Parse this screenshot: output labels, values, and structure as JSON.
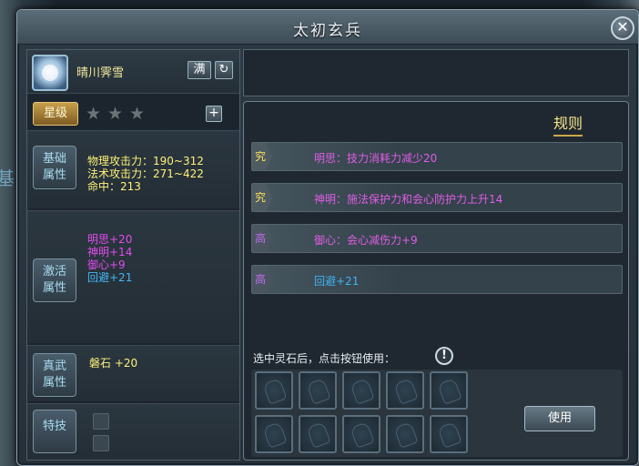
{
  "window": {
    "title": "太初玄兵",
    "close_label": "✕"
  },
  "item": {
    "name": "晴川霁雪",
    "full_label": "满",
    "refresh_label": "↻"
  },
  "star": {
    "label": "星级",
    "stars": [
      "★",
      "★",
      "★"
    ],
    "add_label": "+"
  },
  "sections": {
    "basic": {
      "label1": "基础",
      "label2": "属性",
      "lines": [
        "物理攻击力：190~312",
        "法术攻击力：271~422",
        "命中：213"
      ]
    },
    "activate": {
      "label1": "激活",
      "label2": "属性",
      "lines": [
        "明思+20",
        "神明+14",
        "御心+9",
        "回避+21"
      ]
    },
    "true_martial": {
      "label1": "真武",
      "label2": "属性",
      "line": "磐石 +20"
    },
    "skill": {
      "label": "特技"
    }
  },
  "rules": {
    "title": "规则",
    "rows": [
      {
        "tag": "究",
        "text": "明思：技力消耗力减少20"
      },
      {
        "tag": "究",
        "text": "神明：施法保护力和会心防护力上升14"
      },
      {
        "tag": "高",
        "text": "御心：会心减伤力+9"
      },
      {
        "tag": "高",
        "text": "回避+21"
      }
    ]
  },
  "gems": {
    "hint": "选中灵石后，点击按钮使用：",
    "info_label": "!",
    "use_label": "使用"
  },
  "background": {
    "side_text": "基"
  }
}
